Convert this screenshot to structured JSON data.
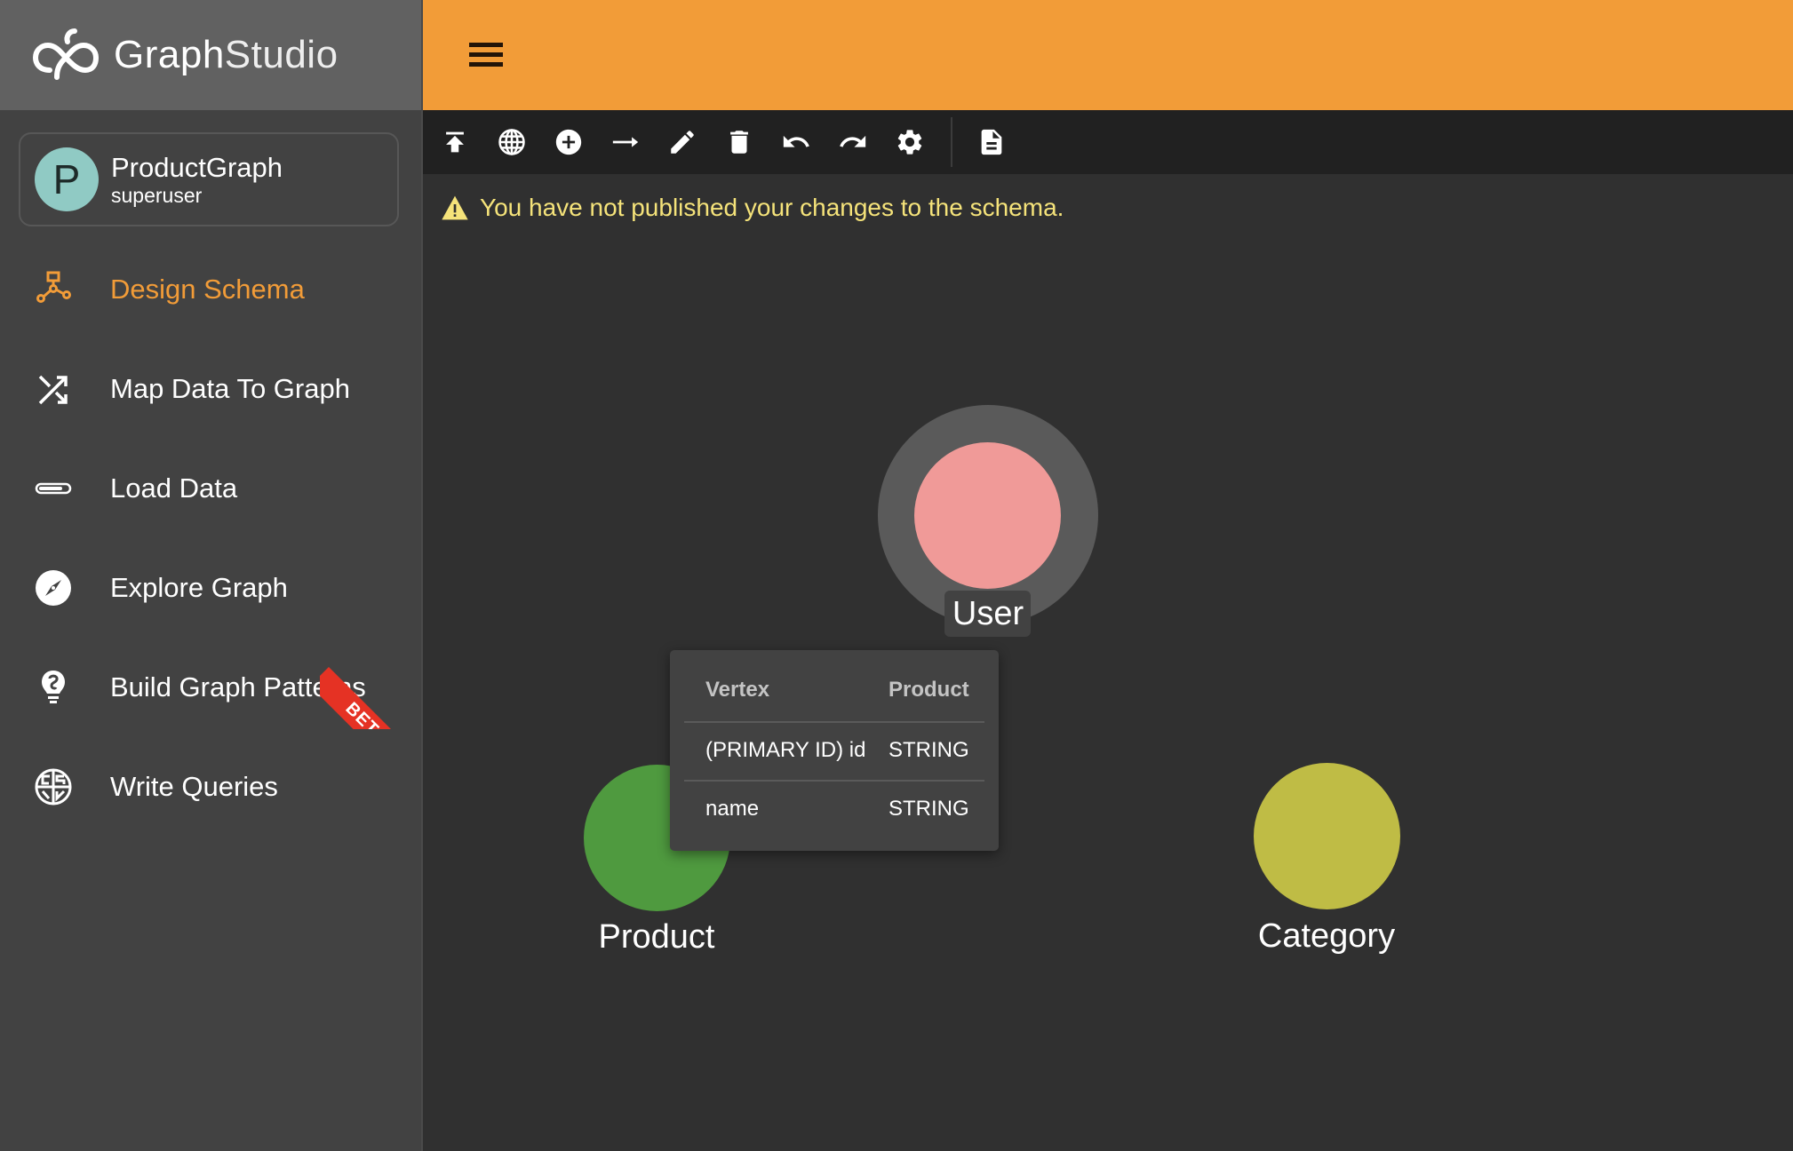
{
  "app": {
    "logo_bold": "Graph",
    "logo_light": "Studio"
  },
  "project": {
    "avatar_letter": "P",
    "name": "ProductGraph",
    "user": "superuser"
  },
  "sidebar": {
    "items": [
      {
        "label": "Design Schema",
        "icon": "schema-icon",
        "active": true
      },
      {
        "label": "Map Data To Graph",
        "icon": "shuffle-icon",
        "active": false
      },
      {
        "label": "Load Data",
        "icon": "progress-bar-icon",
        "active": false
      },
      {
        "label": "Explore Graph",
        "icon": "compass-icon",
        "active": false
      },
      {
        "label": "Build Graph Patterns",
        "icon": "lightbulb-icon",
        "active": false,
        "badge": "BETA"
      },
      {
        "label": "Write Queries",
        "icon": "gsql-icon",
        "active": false
      }
    ]
  },
  "toolbar": {
    "buttons": [
      {
        "name": "publish-schema",
        "icon": "publish-icon"
      },
      {
        "name": "global-types",
        "icon": "globe-icon"
      },
      {
        "name": "add-vertex",
        "icon": "add-circle-icon"
      },
      {
        "name": "add-edge",
        "icon": "arrow-right-icon"
      },
      {
        "name": "edit",
        "icon": "pencil-icon"
      },
      {
        "name": "delete",
        "icon": "trash-icon"
      },
      {
        "name": "undo",
        "icon": "undo-icon"
      },
      {
        "name": "redo",
        "icon": "redo-icon"
      },
      {
        "name": "settings",
        "icon": "gear-icon"
      },
      {
        "name": "export-schema",
        "icon": "document-icon"
      }
    ]
  },
  "warning": {
    "text": "You have not published your changes to the schema."
  },
  "graph": {
    "vertices": [
      {
        "name": "User",
        "color": "#f09a98",
        "selected": true
      },
      {
        "name": "Product",
        "color": "#4f9a3f",
        "selected": false
      },
      {
        "name": "Category",
        "color": "#bfbc45",
        "selected": false
      }
    ]
  },
  "tooltip": {
    "header": [
      "Vertex",
      "Product"
    ],
    "rows": [
      [
        "(PRIMARY ID) id",
        "STRING"
      ],
      [
        "name",
        "STRING"
      ]
    ]
  },
  "colors": {
    "accent": "#f29c38",
    "warning": "#f5e37a",
    "beta": "#e53224"
  }
}
